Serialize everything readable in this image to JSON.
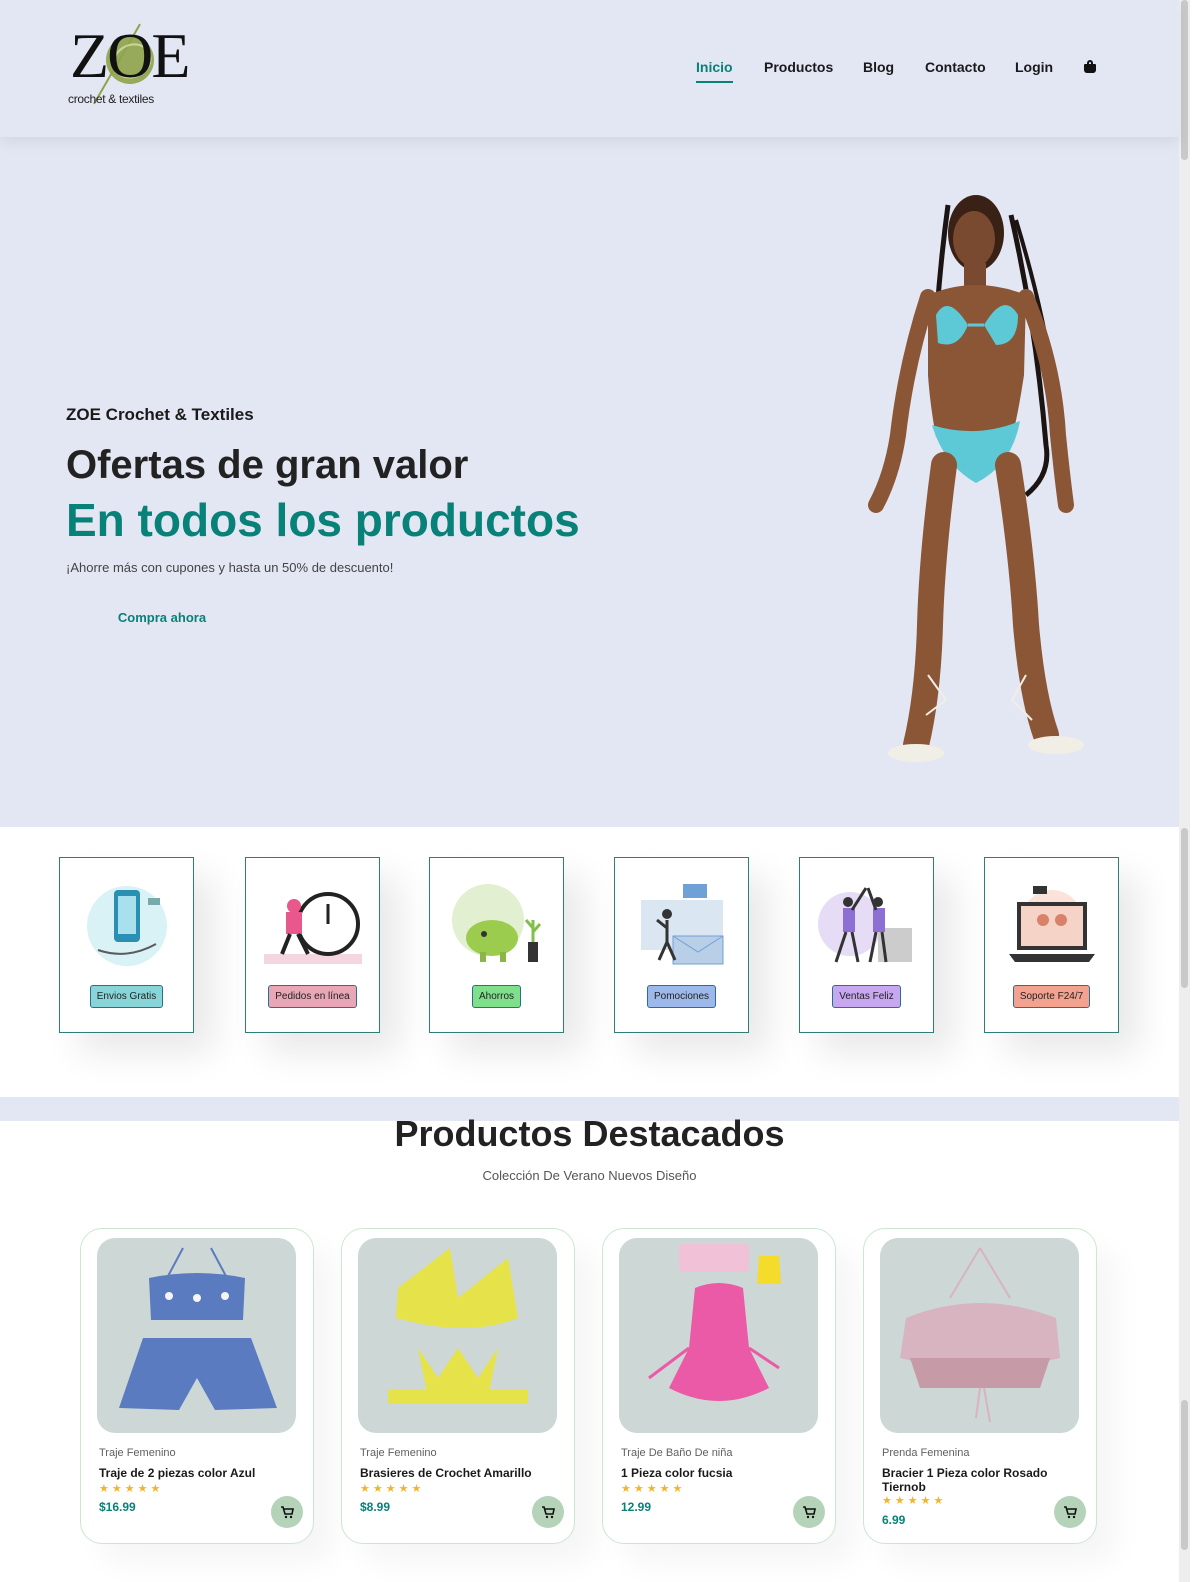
{
  "brand": {
    "logo_letters": "ZOE",
    "logo_tagline": "crochet & textiles"
  },
  "nav": {
    "items": [
      "Inicio",
      "Productos",
      "Blog",
      "Contacto",
      "Login"
    ],
    "active": "Inicio",
    "cart_icon": "shopping-bag-icon"
  },
  "hero": {
    "subtitle": "ZOE Crochet & Textiles",
    "title": "Ofertas de gran valor",
    "title_accent": "En todos los productos",
    "description": "¡Ahorre más con cupones y hasta un 50% de descuento!",
    "button": "Compra ahora",
    "image_icon": "model-in-crochet-bikini"
  },
  "features": [
    {
      "label": "Envios Gratis",
      "color": "#87d5d9"
    },
    {
      "label": "Pedidos en línea",
      "color": "#e9a6b6"
    },
    {
      "label": "Ahorros",
      "color": "#7ee08a"
    },
    {
      "label": "Pomociones",
      "color": "#9db8ea"
    },
    {
      "label": "Ventas Feliz",
      "color": "#c7a7f0"
    },
    {
      "label": "Soporte F24/7",
      "color": "#f2a28f"
    }
  ],
  "products_section": {
    "title": "Productos Destacados",
    "subtitle": "Colección De Verano Nuevos Diseño"
  },
  "products": [
    {
      "brand": "Traje Femenino",
      "name": "Traje de 2 piezas color Azul",
      "rating": 5,
      "price": "$16.99",
      "item_color": "#5a7bc0"
    },
    {
      "brand": "Traje Femenino",
      "name": "Brasieres de Crochet Amarillo",
      "rating": 5,
      "price": "$8.99",
      "item_color": "#e6e24a"
    },
    {
      "brand": "Traje De Baño De niña",
      "name": "1 Pieza color fucsia",
      "rating": 5,
      "price": "12.99",
      "item_color": "#ea5aa6"
    },
    {
      "brand": "Prenda Femenina",
      "name": "Bracier 1 Pieza color Rosado Tiernob",
      "rating": 5,
      "price": "6.99",
      "item_color": "#d7b4bf"
    }
  ],
  "colors": {
    "accent": "#088178",
    "bg_soft": "#e3e6f3",
    "star": "#f3b32e"
  }
}
